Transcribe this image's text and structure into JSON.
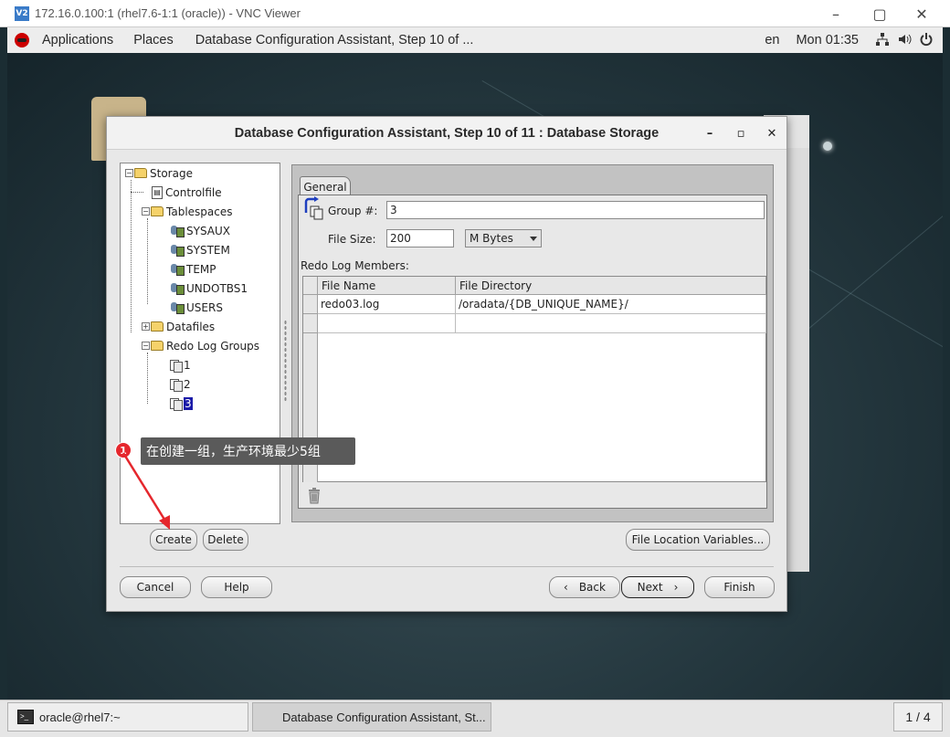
{
  "vnc": {
    "logo": "V2",
    "title": "172.16.0.100:1 (rhel7.6-1:1 (oracle)) - VNC Viewer",
    "minimize_icon": "minimize-icon",
    "maximize_icon": "maximize-icon",
    "close_icon": "close-icon"
  },
  "gnome": {
    "applications": "Applications",
    "places": "Places",
    "active_window": "Database Configuration Assistant, Step 10 of ...",
    "lang": "en",
    "clock": "Mon 01:35"
  },
  "dialog": {
    "title": "Database Configuration Assistant, Step 10 of 11 : Database Storage",
    "minimize": "–",
    "maximize": "▫",
    "close": "✕"
  },
  "tree": {
    "storage": "Storage",
    "controlfile": "Controlfile",
    "tablespaces": "Tablespaces",
    "tablespace_items": [
      "SYSAUX",
      "SYSTEM",
      "TEMP",
      "UNDOTBS1",
      "USERS"
    ],
    "datafiles": "Datafiles",
    "redo_log_groups": "Redo Log Groups",
    "redo_items": [
      "1",
      "2",
      "3"
    ],
    "selected": "3"
  },
  "form": {
    "tab": "General",
    "group_label": "Group #:",
    "group_value": "3",
    "file_size_label": "File Size:",
    "file_size_value": "200",
    "unit": "M Bytes",
    "members_label": "Redo Log Members:",
    "columns": [
      "File Name",
      "File Directory"
    ],
    "rows": [
      {
        "file_name": "redo03.log",
        "file_directory": "/oradata/{DB_UNIQUE_NAME}/"
      },
      {
        "file_name": "",
        "file_directory": ""
      }
    ]
  },
  "buttons": {
    "create": "Create",
    "delete": "Delete",
    "file_location_variables": "File Location Variables...",
    "cancel": "Cancel",
    "help": "Help",
    "back": "Back",
    "next": "Next",
    "finish": "Finish"
  },
  "annotation": {
    "number": "1",
    "text": "在创建一组，生产环境最少5组"
  },
  "taskbar": {
    "terminal": "oracle@rhel7:~",
    "dbca": "Database Configuration Assistant, St...",
    "workspace": "1 / 4"
  },
  "colors": {
    "selection": "#1a1aa8",
    "annotation_red": "#e5272d",
    "desktop": "#24373e"
  }
}
